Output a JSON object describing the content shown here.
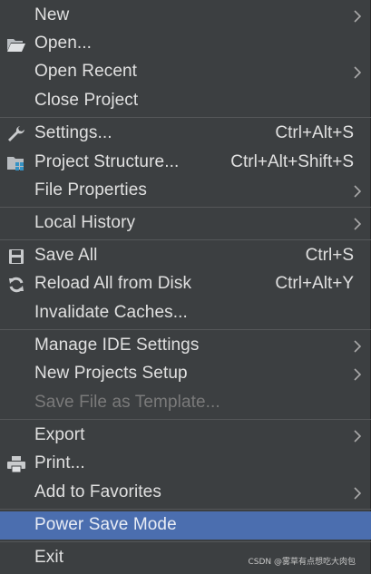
{
  "menu": {
    "new": {
      "label": "New",
      "icon": "none",
      "submenu": true
    },
    "open": {
      "label": "Open...",
      "icon": "folder-open-icon"
    },
    "open_recent": {
      "label": "Open Recent",
      "submenu": true
    },
    "close_project": {
      "label": "Close Project"
    },
    "settings": {
      "label": "Settings...",
      "shortcut": "Ctrl+Alt+S",
      "icon": "wrench-icon"
    },
    "project_structure": {
      "label": "Project Structure...",
      "shortcut": "Ctrl+Alt+Shift+S",
      "icon": "project-structure-icon"
    },
    "file_properties": {
      "label": "File Properties",
      "submenu": true
    },
    "local_history": {
      "label": "Local History",
      "submenu": true
    },
    "save_all": {
      "label": "Save All",
      "shortcut": "Ctrl+S",
      "icon": "floppy-disk-icon"
    },
    "reload_all": {
      "label": "Reload All from Disk",
      "shortcut": "Ctrl+Alt+Y",
      "icon": "refresh-icon"
    },
    "invalidate_caches": {
      "label": "Invalidate Caches..."
    },
    "manage_ide_settings": {
      "label": "Manage IDE Settings",
      "submenu": true
    },
    "new_projects_setup": {
      "label": "New Projects Setup",
      "submenu": true
    },
    "save_file_as_template": {
      "label": "Save File as Template...",
      "disabled": true
    },
    "export": {
      "label": "Export",
      "submenu": true
    },
    "print": {
      "label": "Print...",
      "icon": "printer-icon"
    },
    "add_to_favorites": {
      "label": "Add to Favorites",
      "submenu": true
    },
    "power_save_mode": {
      "label": "Power Save Mode",
      "selected": true
    },
    "exit": {
      "label": "Exit"
    }
  },
  "watermark": "CSDN @雾草有点想吃大肉包",
  "colors": {
    "background": "#3c3f41",
    "text": "#e0e0e0",
    "disabled_text": "#7a7a7a",
    "separator": "#555759",
    "selection": "#4b6eaf"
  }
}
